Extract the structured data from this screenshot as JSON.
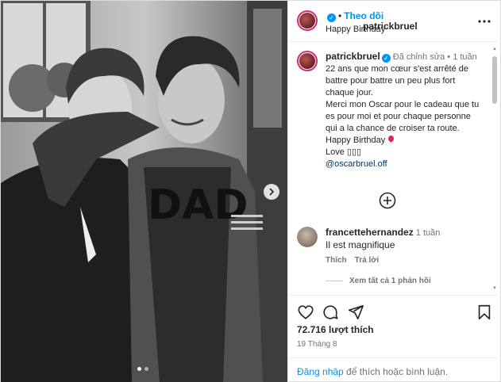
{
  "post": {
    "author": "patrickbruel",
    "follow_label": "Theo dõi",
    "separator": "•",
    "subtitle": "Happy Birthday",
    "shirt_text": "DAD",
    "carousel": {
      "slide_count": 2,
      "active_slide": 1
    }
  },
  "caption": {
    "author": "patrickbruel",
    "edited": "Đã chỉnh sửa",
    "time": "1 tuần",
    "lines": [
      "22 ans que mon cœur s'est arrêté de battre pour battre un peu plus fort chaque jour.",
      "Merci mon Oscar pour le cadeau que tu es pour moi et pour chaque personne qui a la chance de croiser ta route.",
      "Happy Birthday",
      "Love ▯▯▯"
    ],
    "mention": "@oscarbruel.off"
  },
  "comment": {
    "author": "francettehernandez",
    "time": "1 tuần",
    "text": "Il est magnifique",
    "like_label": "Thích",
    "reply_label": "Trả lời",
    "view_replies": "Xem tất cả 1 phản hồi"
  },
  "stats": {
    "likes": "72.716 lượt thích",
    "date": "19 Tháng 8"
  },
  "login": {
    "link": "Đăng nhập",
    "rest": " để thích hoặc bình luận."
  },
  "colors": {
    "accent": "#0095f6",
    "story_ring": "#d62976",
    "mention": "#00376b"
  },
  "icons": [
    "more-options-icon",
    "chevron-right-icon",
    "add-comment-icon",
    "heart-icon",
    "comment-icon",
    "share-icon",
    "bookmark-icon",
    "verified-badge-icon",
    "balloon-icon"
  ]
}
